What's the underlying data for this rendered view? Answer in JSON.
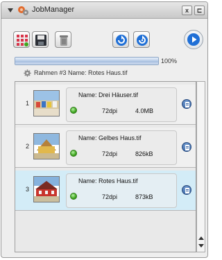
{
  "window": {
    "title": "JobManager",
    "close_label": "x",
    "detach_label": "⊏"
  },
  "toolbar": {
    "buttons": [
      {
        "icon": "grid-icon"
      },
      {
        "icon": "save-disk-icon"
      },
      {
        "icon": "trash-icon"
      },
      {
        "icon": "refresh-icon"
      },
      {
        "icon": "refresh-all-icon"
      },
      {
        "icon": "play-icon"
      }
    ]
  },
  "progress": {
    "value": 1.0,
    "label": "100%"
  },
  "status": {
    "icon": "gear-icon",
    "text": "Rahmen #3 Name: Rotes Haus.tif"
  },
  "jobs": [
    {
      "index": "1",
      "name": "Name: Drei Häuser.tif",
      "dpi": "72dpi",
      "size": "4.0MB",
      "status_color": "#3fa61f",
      "selected": false
    },
    {
      "index": "2",
      "name": "Name: Gelbes Haus.tif",
      "dpi": "72dpi",
      "size": "826kB",
      "status_color": "#3fa61f",
      "selected": false
    },
    {
      "index": "3",
      "name": "Name: Rotes Haus.tif",
      "dpi": "72dpi",
      "size": "873kB",
      "status_color": "#3fa61f",
      "selected": true
    }
  ],
  "colors": {
    "selection": "#d3ecf7",
    "accent_blue": "#1f6fd6",
    "status_green": "#3fa61f"
  }
}
